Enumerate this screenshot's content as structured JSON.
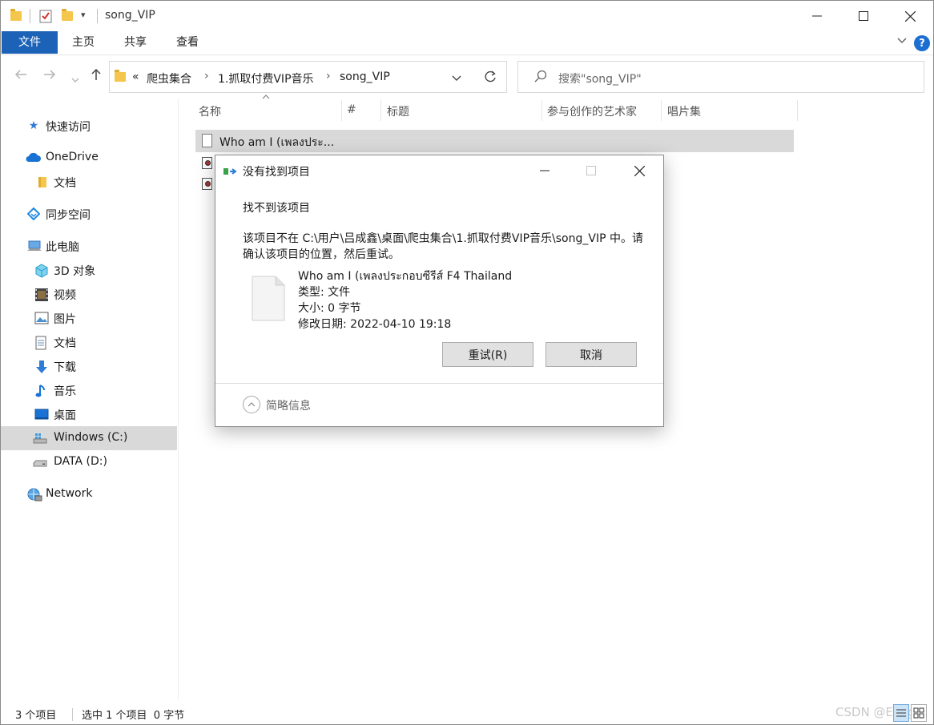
{
  "window": {
    "title": "song_VIP",
    "quick_access_dropdown": "▾"
  },
  "ribbon": {
    "tabs": [
      "文件",
      "主页",
      "共享",
      "查看"
    ]
  },
  "address": {
    "overflow": "«",
    "parts": [
      "爬虫集合",
      "1.抓取付费VIP音乐",
      "song_VIP"
    ],
    "separator": "›"
  },
  "search": {
    "placeholder": "搜索\"song_VIP\""
  },
  "sidebar": {
    "items": [
      {
        "label": "快速访问",
        "icon": "star-icon"
      },
      {
        "label": "OneDrive",
        "icon": "cloud-icon"
      },
      {
        "label": "文档",
        "icon": "folder-icon"
      },
      {
        "label": "同步空间",
        "icon": "sync-icon"
      },
      {
        "label": "此电脑",
        "icon": "computer-icon"
      },
      {
        "label": "3D 对象",
        "icon": "cube-icon"
      },
      {
        "label": "视频",
        "icon": "video-icon"
      },
      {
        "label": "图片",
        "icon": "picture-icon"
      },
      {
        "label": "文档",
        "icon": "document-icon"
      },
      {
        "label": "下载",
        "icon": "download-icon"
      },
      {
        "label": "音乐",
        "icon": "music-icon"
      },
      {
        "label": "桌面",
        "icon": "desktop-icon"
      },
      {
        "label": "Windows (C:)",
        "icon": "drive-c-icon"
      },
      {
        "label": "DATA (D:)",
        "icon": "drive-d-icon"
      },
      {
        "label": "Network",
        "icon": "network-icon"
      }
    ]
  },
  "columns": [
    "名称",
    "#",
    "标题",
    "参与创作的艺术家",
    "唱片集"
  ],
  "files": [
    {
      "name": "Who am I (เพลงประ..."
    }
  ],
  "status": {
    "count": "3 个项目",
    "selection": "选中 1 个项目  0 字节"
  },
  "watermark": "CSDN @Evog",
  "dialog": {
    "title": "没有找到项目",
    "heading": "找不到该项目",
    "message": "该项目不在 C:\\用户\\吕成鑫\\桌面\\爬虫集合\\1.抓取付费VIP音乐\\song_VIP 中。请确认该项目的位置，然后重试。",
    "file_name": "Who am I (เพลงประกอบซีรีส์ F4 Thailand",
    "file_type": "类型: 文件",
    "file_size": "大小: 0 字节",
    "file_date": "修改日期: 2022-04-10 19:18",
    "retry_label": "重试(R)",
    "cancel_label": "取消",
    "details_label": "简略信息"
  }
}
